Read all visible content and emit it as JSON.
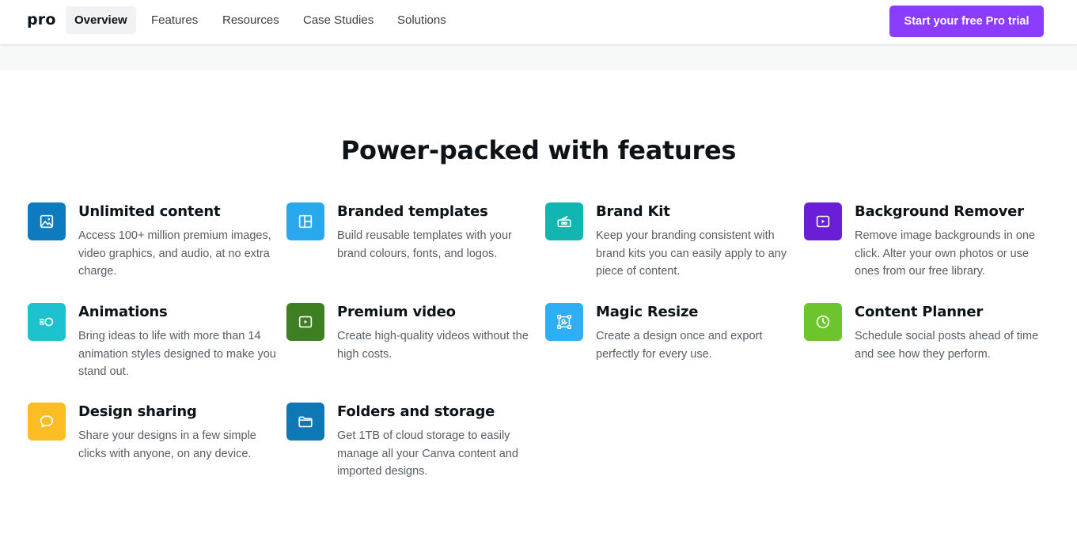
{
  "nav": {
    "brand": "pro",
    "items": [
      {
        "label": "Overview",
        "active": true
      },
      {
        "label": "Features",
        "active": false
      },
      {
        "label": "Resources",
        "active": false
      },
      {
        "label": "Case Studies",
        "active": false
      },
      {
        "label": "Solutions",
        "active": false
      }
    ],
    "cta_label": "Start your free Pro trial"
  },
  "section": {
    "heading": "Power-packed with features"
  },
  "features": [
    {
      "title": "Unlimited content",
      "desc": "Access 100+ million premium images, video graphics, and audio, at no extra charge.",
      "icon": "image-icon",
      "color": "#0f7bbf"
    },
    {
      "title": "Branded templates",
      "desc": "Build reusable templates with your brand colours, fonts, and logos.",
      "icon": "template-icon",
      "color": "#29a8ee"
    },
    {
      "title": "Brand Kit",
      "desc": "Keep your branding consistent with brand kits you can easily apply to any piece of content.",
      "icon": "brand-kit-icon",
      "color": "#13b5b1"
    },
    {
      "title": "Background Remover",
      "desc": "Remove image backgrounds in one click. Alter your own photos or use ones from our free library.",
      "icon": "background-remover-icon",
      "color": "#6a1ed6"
    },
    {
      "title": "Animations",
      "desc": "Bring ideas to life with more than 14 animation styles designed to make you stand out.",
      "icon": "animation-icon",
      "color": "#1ec2cf"
    },
    {
      "title": "Premium video",
      "desc": "Create high-quality videos without the high costs.",
      "icon": "video-play-icon",
      "color": "#3d7f22"
    },
    {
      "title": "Magic Resize",
      "desc": "Create a design once and export perfectly for every use.",
      "icon": "resize-icon",
      "color": "#2eaef5"
    },
    {
      "title": "Content Planner",
      "desc": "Schedule social posts ahead of time and see how they perform.",
      "icon": "clock-icon",
      "color": "#6cc52c"
    },
    {
      "title": "Design sharing",
      "desc": "Share your designs in a few simple clicks with anyone, on any device.",
      "icon": "speech-bubble-icon",
      "color": "#fbbd23"
    },
    {
      "title": "Folders and storage",
      "desc": "Get 1TB of cloud storage to easily manage all your Canva content and imported designs.",
      "icon": "folder-icon",
      "color": "#0e78b4"
    }
  ]
}
